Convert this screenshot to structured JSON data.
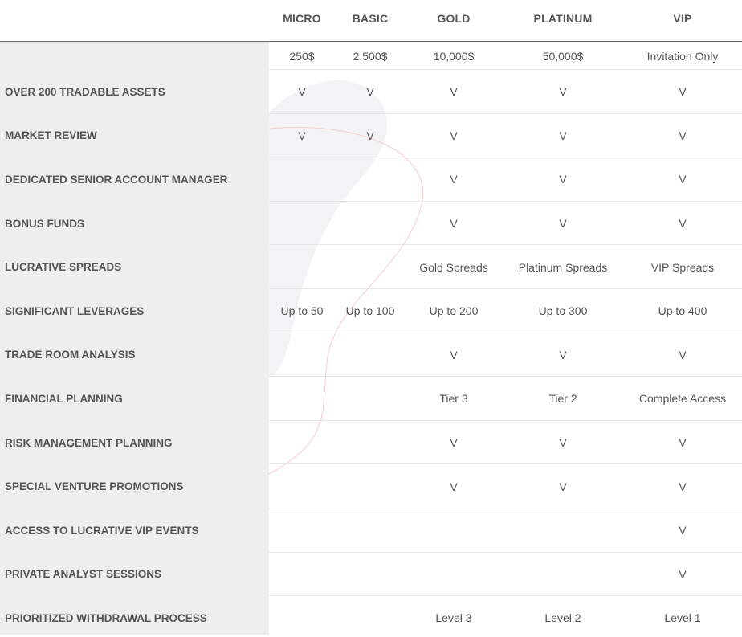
{
  "columns": [
    "MICRO",
    "BASIC",
    "GOLD",
    "PLATINUM",
    "VIP"
  ],
  "prices": [
    "250$",
    "2,500$",
    "10,000$",
    "50,000$",
    "Invitation Only"
  ],
  "rows": [
    {
      "label": "OVER 200 TRADABLE ASSETS",
      "values": [
        "V",
        "V",
        "V",
        "V",
        "V"
      ]
    },
    {
      "label": "MARKET REVIEW",
      "values": [
        "V",
        "V",
        "V",
        "V",
        "V"
      ]
    },
    {
      "label": "DEDICATED SENIOR ACCOUNT MANAGER",
      "values": [
        "",
        "",
        "V",
        "V",
        "V"
      ]
    },
    {
      "label": "BONUS FUNDS",
      "values": [
        "",
        "",
        "V",
        "V",
        "V"
      ]
    },
    {
      "label": "LUCRATIVE SPREADS",
      "values": [
        "",
        "",
        "Gold Spreads",
        "Platinum Spreads",
        "VIP Spreads"
      ]
    },
    {
      "label": "SIGNIFICANT LEVERAGES",
      "values": [
        "Up to 50",
        "Up to 100",
        "Up to 200",
        "Up to 300",
        "Up to 400"
      ]
    },
    {
      "label": "TRADE ROOM ANALYSIS",
      "values": [
        "",
        "",
        "V",
        "V",
        "V"
      ]
    },
    {
      "label": "FINANCIAL PLANNING",
      "values": [
        "",
        "",
        "Tier 3",
        "Tier 2",
        "Complete Access"
      ]
    },
    {
      "label": "RISK MANAGEMENT PLANNING",
      "values": [
        "",
        "",
        "V",
        "V",
        "V"
      ]
    },
    {
      "label": "SPECIAL VENTURE PROMOTIONS",
      "values": [
        "",
        "",
        "V",
        "V",
        "V"
      ]
    },
    {
      "label": "ACCESS TO LUCRATIVE VIP EVENTS",
      "values": [
        "",
        "",
        "",
        "",
        "V"
      ]
    },
    {
      "label": "PRIVATE ANALYST SESSIONS",
      "values": [
        "",
        "",
        "",
        "",
        "V"
      ]
    },
    {
      "label": "PRIORITIZED WITHDRAWAL PROCESS",
      "values": [
        "",
        "",
        "Level 3",
        "Level 2",
        "Level 1"
      ]
    }
  ]
}
